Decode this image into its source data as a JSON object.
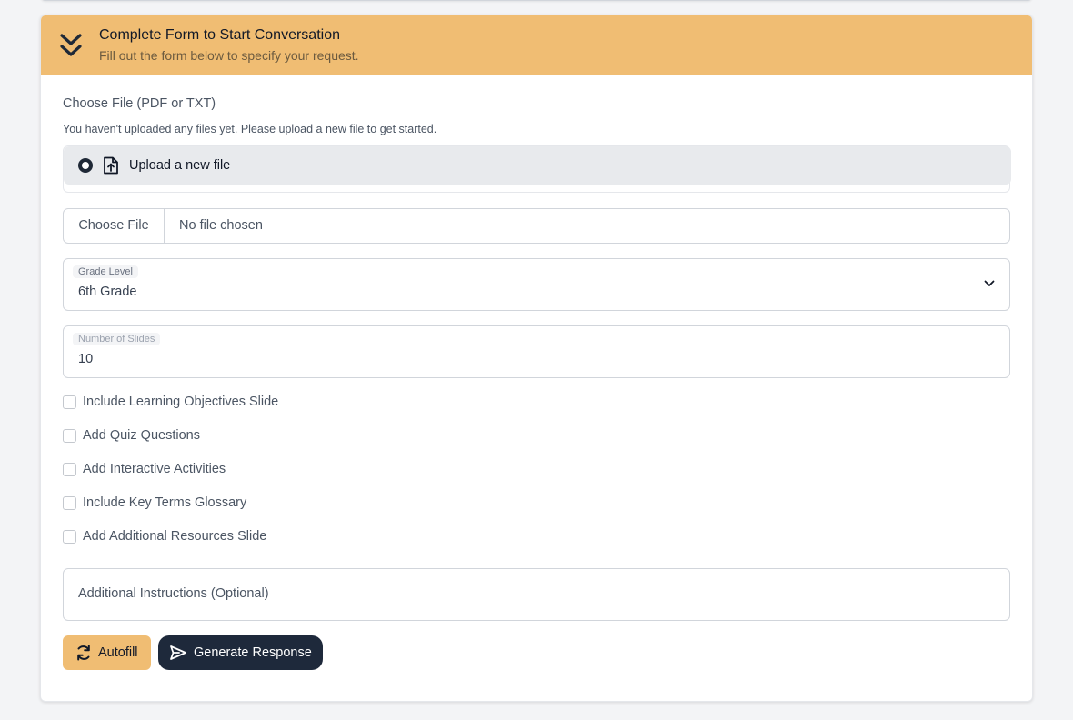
{
  "header": {
    "title": "Complete Form to Start Conversation",
    "subtitle": "Fill out the form below to specify your request."
  },
  "file_section": {
    "label": "Choose File (PDF or TXT)",
    "hint": "You haven't uploaded any files yet. Please upload a new file to get started.",
    "option_label": "Upload a new file",
    "option_selected": true,
    "button_label": "Choose File",
    "status": "No file chosen"
  },
  "grade_level": {
    "label": "Grade Level",
    "value": "6th Grade"
  },
  "num_slides": {
    "label": "Number of Slides",
    "value": "10"
  },
  "options": [
    {
      "label": "Include Learning Objectives Slide",
      "checked": false
    },
    {
      "label": "Add Quiz Questions",
      "checked": false
    },
    {
      "label": "Add Interactive Activities",
      "checked": false
    },
    {
      "label": "Include Key Terms Glossary",
      "checked": false
    },
    {
      "label": "Add Additional Resources Slide",
      "checked": false
    }
  ],
  "instructions": {
    "placeholder": "Additional Instructions (Optional)"
  },
  "buttons": {
    "autofill": "Autofill",
    "generate": "Generate Response"
  },
  "colors": {
    "accent": "#f0bd73",
    "dark_button": "#1e293b",
    "background": "#f3f4f6"
  },
  "icons": {
    "header": "double-chevron-down-icon",
    "upload": "file-upload-icon",
    "select": "chevron-down-icon",
    "autofill": "refresh-icon",
    "generate": "send-icon"
  }
}
